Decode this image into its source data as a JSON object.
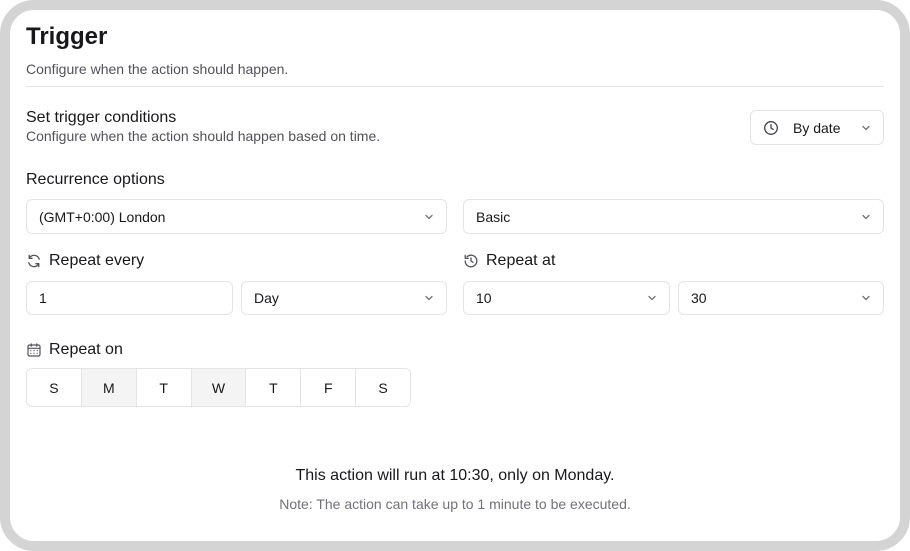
{
  "header": {
    "title": "Trigger",
    "subtitle": "Configure when the action should happen."
  },
  "conditions": {
    "title": "Set trigger conditions",
    "subtitle": "Configure when the action should happen based on time.",
    "mode_select": {
      "value": "By date",
      "icon": "clock-icon"
    }
  },
  "recurrence": {
    "label": "Recurrence options",
    "timezone": "(GMT+0:00) London",
    "mode": "Basic"
  },
  "repeat_every": {
    "label": "Repeat every",
    "icon": "refresh-icon",
    "value": "1",
    "unit": "Day"
  },
  "repeat_at": {
    "label": "Repeat at",
    "icon": "history-icon",
    "hour": "10",
    "minute": "30"
  },
  "repeat_on": {
    "label": "Repeat on",
    "icon": "calendar-icon",
    "days": [
      {
        "label": "S",
        "selected": false
      },
      {
        "label": "M",
        "selected": true
      },
      {
        "label": "T",
        "selected": false
      },
      {
        "label": "W",
        "selected": true
      },
      {
        "label": "T",
        "selected": false
      },
      {
        "label": "F",
        "selected": false
      },
      {
        "label": "S",
        "selected": false
      }
    ]
  },
  "footer": {
    "summary": "This action will run at 10:30, only on Monday.",
    "note": "Note: The action can take up to 1 minute to be executed."
  }
}
